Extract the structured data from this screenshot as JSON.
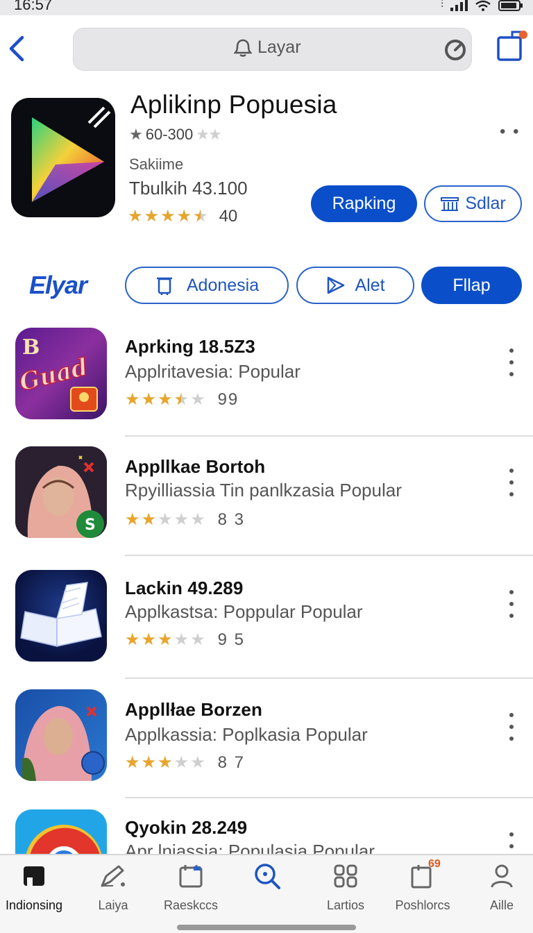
{
  "status_bar": {
    "time": "16:57"
  },
  "search": {
    "query": "Layar"
  },
  "hero": {
    "title": "Aplikinp Popuesia",
    "rating_text": "60-300",
    "subtitle1": "Sakiime",
    "subtitle2": "Tbulkih 43.100",
    "stars": 4.5,
    "rating_count": "40",
    "primary_button": "Rapking",
    "secondary_button": "Sdlar"
  },
  "filter": {
    "brand": "Elyar",
    "chips": [
      {
        "label": "Adonesia"
      },
      {
        "label": "Alet"
      },
      {
        "label": "Fllap"
      }
    ]
  },
  "apps": [
    {
      "name": "Aprking 18.5Z3",
      "category": "Applritavesia: Popular",
      "stars": 3.5,
      "count": "99"
    },
    {
      "name": "Appllkae Bortoh",
      "category": "Rpyilliassia Tin panlkzasia Popular",
      "stars": 2,
      "count": "8 3"
    },
    {
      "name": "Lackin 49.289",
      "category": "Applkastsa: Poppular Popular",
      "stars": 3,
      "count": "9 5"
    },
    {
      "name": "Appllłae Borzen",
      "category": "Applkassia: Poplkasia Popular",
      "stars": 3,
      "count": "8 7"
    },
    {
      "name": "Qyokin 28.249",
      "category": "Apr lniassia: Populasia Popular",
      "stars": 0,
      "count": ""
    }
  ],
  "tabs": [
    {
      "label": "Indionsing",
      "icon": "home-icon"
    },
    {
      "label": "Laiya",
      "icon": "edit-icon"
    },
    {
      "label": "Raeskccs",
      "icon": "calendar-icon"
    },
    {
      "label": "",
      "icon": "search-icon"
    },
    {
      "label": "Lartios",
      "icon": "grid-icon"
    },
    {
      "label": "Poshlorcs",
      "icon": "notification-icon",
      "badge": "69"
    },
    {
      "label": "Aille",
      "icon": "person-icon"
    }
  ],
  "colors": {
    "accent": "#0a4fc9",
    "star": "#e8a52c",
    "star_empty": "#cfcfcf"
  }
}
